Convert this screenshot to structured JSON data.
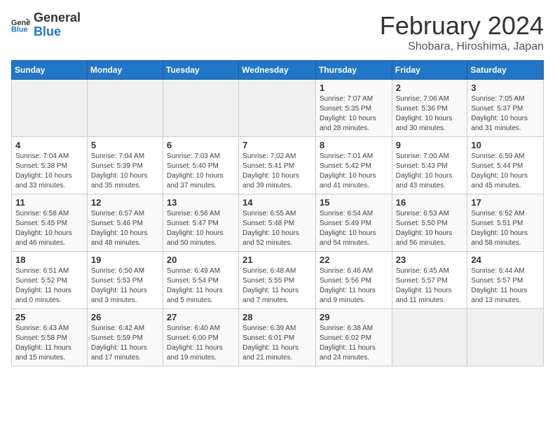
{
  "header": {
    "logo": {
      "general": "General",
      "blue": "Blue"
    },
    "month": "February 2024",
    "location": "Shobara, Hiroshima, Japan"
  },
  "weekdays": [
    "Sunday",
    "Monday",
    "Tuesday",
    "Wednesday",
    "Thursday",
    "Friday",
    "Saturday"
  ],
  "weeks": [
    [
      {
        "day": "",
        "empty": true
      },
      {
        "day": "",
        "empty": true
      },
      {
        "day": "",
        "empty": true
      },
      {
        "day": "",
        "empty": true
      },
      {
        "day": "1",
        "sunrise": "7:07 AM",
        "sunset": "5:35 PM",
        "daylight": "10 hours and 28 minutes."
      },
      {
        "day": "2",
        "sunrise": "7:06 AM",
        "sunset": "5:36 PM",
        "daylight": "10 hours and 30 minutes."
      },
      {
        "day": "3",
        "sunrise": "7:05 AM",
        "sunset": "5:37 PM",
        "daylight": "10 hours and 31 minutes."
      }
    ],
    [
      {
        "day": "4",
        "sunrise": "7:04 AM",
        "sunset": "5:38 PM",
        "daylight": "10 hours and 33 minutes."
      },
      {
        "day": "5",
        "sunrise": "7:04 AM",
        "sunset": "5:39 PM",
        "daylight": "10 hours and 35 minutes."
      },
      {
        "day": "6",
        "sunrise": "7:03 AM",
        "sunset": "5:40 PM",
        "daylight": "10 hours and 37 minutes."
      },
      {
        "day": "7",
        "sunrise": "7:02 AM",
        "sunset": "5:41 PM",
        "daylight": "10 hours and 39 minutes."
      },
      {
        "day": "8",
        "sunrise": "7:01 AM",
        "sunset": "5:42 PM",
        "daylight": "10 hours and 41 minutes."
      },
      {
        "day": "9",
        "sunrise": "7:00 AM",
        "sunset": "5:43 PM",
        "daylight": "10 hours and 43 minutes."
      },
      {
        "day": "10",
        "sunrise": "6:59 AM",
        "sunset": "5:44 PM",
        "daylight": "10 hours and 45 minutes."
      }
    ],
    [
      {
        "day": "11",
        "sunrise": "6:58 AM",
        "sunset": "5:45 PM",
        "daylight": "10 hours and 46 minutes."
      },
      {
        "day": "12",
        "sunrise": "6:57 AM",
        "sunset": "5:46 PM",
        "daylight": "10 hours and 48 minutes."
      },
      {
        "day": "13",
        "sunrise": "6:56 AM",
        "sunset": "5:47 PM",
        "daylight": "10 hours and 50 minutes."
      },
      {
        "day": "14",
        "sunrise": "6:55 AM",
        "sunset": "5:48 PM",
        "daylight": "10 hours and 52 minutes."
      },
      {
        "day": "15",
        "sunrise": "6:54 AM",
        "sunset": "5:49 PM",
        "daylight": "10 hours and 54 minutes."
      },
      {
        "day": "16",
        "sunrise": "6:53 AM",
        "sunset": "5:50 PM",
        "daylight": "10 hours and 56 minutes."
      },
      {
        "day": "17",
        "sunrise": "6:52 AM",
        "sunset": "5:51 PM",
        "daylight": "10 hours and 58 minutes."
      }
    ],
    [
      {
        "day": "18",
        "sunrise": "6:51 AM",
        "sunset": "5:52 PM",
        "daylight": "11 hours and 0 minutes."
      },
      {
        "day": "19",
        "sunrise": "6:50 AM",
        "sunset": "5:53 PM",
        "daylight": "11 hours and 3 minutes."
      },
      {
        "day": "20",
        "sunrise": "6:49 AM",
        "sunset": "5:54 PM",
        "daylight": "11 hours and 5 minutes."
      },
      {
        "day": "21",
        "sunrise": "6:48 AM",
        "sunset": "5:55 PM",
        "daylight": "11 hours and 7 minutes."
      },
      {
        "day": "22",
        "sunrise": "6:46 AM",
        "sunset": "5:56 PM",
        "daylight": "11 hours and 9 minutes."
      },
      {
        "day": "23",
        "sunrise": "6:45 AM",
        "sunset": "5:57 PM",
        "daylight": "11 hours and 11 minutes."
      },
      {
        "day": "24",
        "sunrise": "6:44 AM",
        "sunset": "5:57 PM",
        "daylight": "11 hours and 13 minutes."
      }
    ],
    [
      {
        "day": "25",
        "sunrise": "6:43 AM",
        "sunset": "5:58 PM",
        "daylight": "11 hours and 15 minutes."
      },
      {
        "day": "26",
        "sunrise": "6:42 AM",
        "sunset": "5:59 PM",
        "daylight": "11 hours and 17 minutes."
      },
      {
        "day": "27",
        "sunrise": "6:40 AM",
        "sunset": "6:00 PM",
        "daylight": "11 hours and 19 minutes."
      },
      {
        "day": "28",
        "sunrise": "6:39 AM",
        "sunset": "6:01 PM",
        "daylight": "11 hours and 21 minutes."
      },
      {
        "day": "29",
        "sunrise": "6:38 AM",
        "sunset": "6:02 PM",
        "daylight": "11 hours and 24 minutes."
      },
      {
        "day": "",
        "empty": true
      },
      {
        "day": "",
        "empty": true
      }
    ]
  ],
  "labels": {
    "sunrise_prefix": "Sunrise: ",
    "sunset_prefix": "Sunset: ",
    "daylight_prefix": "Daylight: "
  }
}
